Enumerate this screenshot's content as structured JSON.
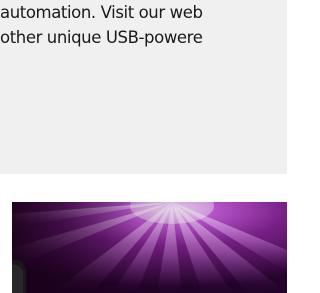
{
  "article": {
    "lines": [
      "automation. Visit our web",
      "other unique USB-powere"
    ]
  },
  "image": {
    "icon": "purple-light-burst-product-image",
    "colors": {
      "deep": "#35093f",
      "mid": "#8a2a9c",
      "bright": "#e3a6f2",
      "glow": "#ffffff"
    }
  }
}
